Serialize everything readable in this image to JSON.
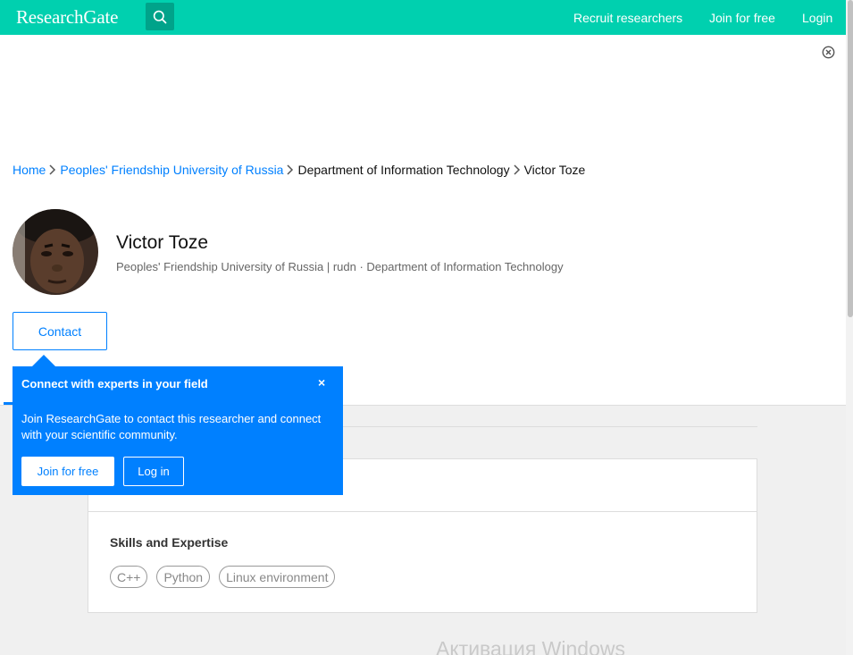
{
  "header": {
    "logo_text": "ResearchGate",
    "search_icon": "search-icon",
    "recruit_label": "Recruit researchers",
    "join_label": "Join for free",
    "login_label": "Login"
  },
  "ad": {
    "close_icon": "close-circle-icon"
  },
  "breadcrumb": {
    "items": [
      {
        "label": "Home",
        "link": true
      },
      {
        "label": "Peoples' Friendship University of Russia",
        "link": true
      },
      {
        "label": "Department of Information Technology",
        "link": false
      },
      {
        "label": "Victor Toze",
        "link": false
      }
    ],
    "separator_icon": "chevron-right-icon"
  },
  "profile": {
    "name": "Victor Toze",
    "affiliation": "Peoples' Friendship University of Russia | rudn · Department of Information Technology",
    "contact_label": "Contact",
    "avatar_icon": "avatar"
  },
  "skills": {
    "title": "Skills and Expertise",
    "items": [
      "C++",
      "Python",
      "Linux environment"
    ]
  },
  "popup": {
    "title": "Connect with experts in your field",
    "close_glyph": "×",
    "body": "Join ResearchGate to contact this researcher and connect with your scientific community.",
    "join_label": "Join for free",
    "login_label": "Log in"
  },
  "watermark": {
    "text": "Активация Windows"
  },
  "colors": {
    "brand": "#00d0af",
    "brand_dark": "#00a38a",
    "link": "#0080ff",
    "popup": "#0080ff"
  }
}
